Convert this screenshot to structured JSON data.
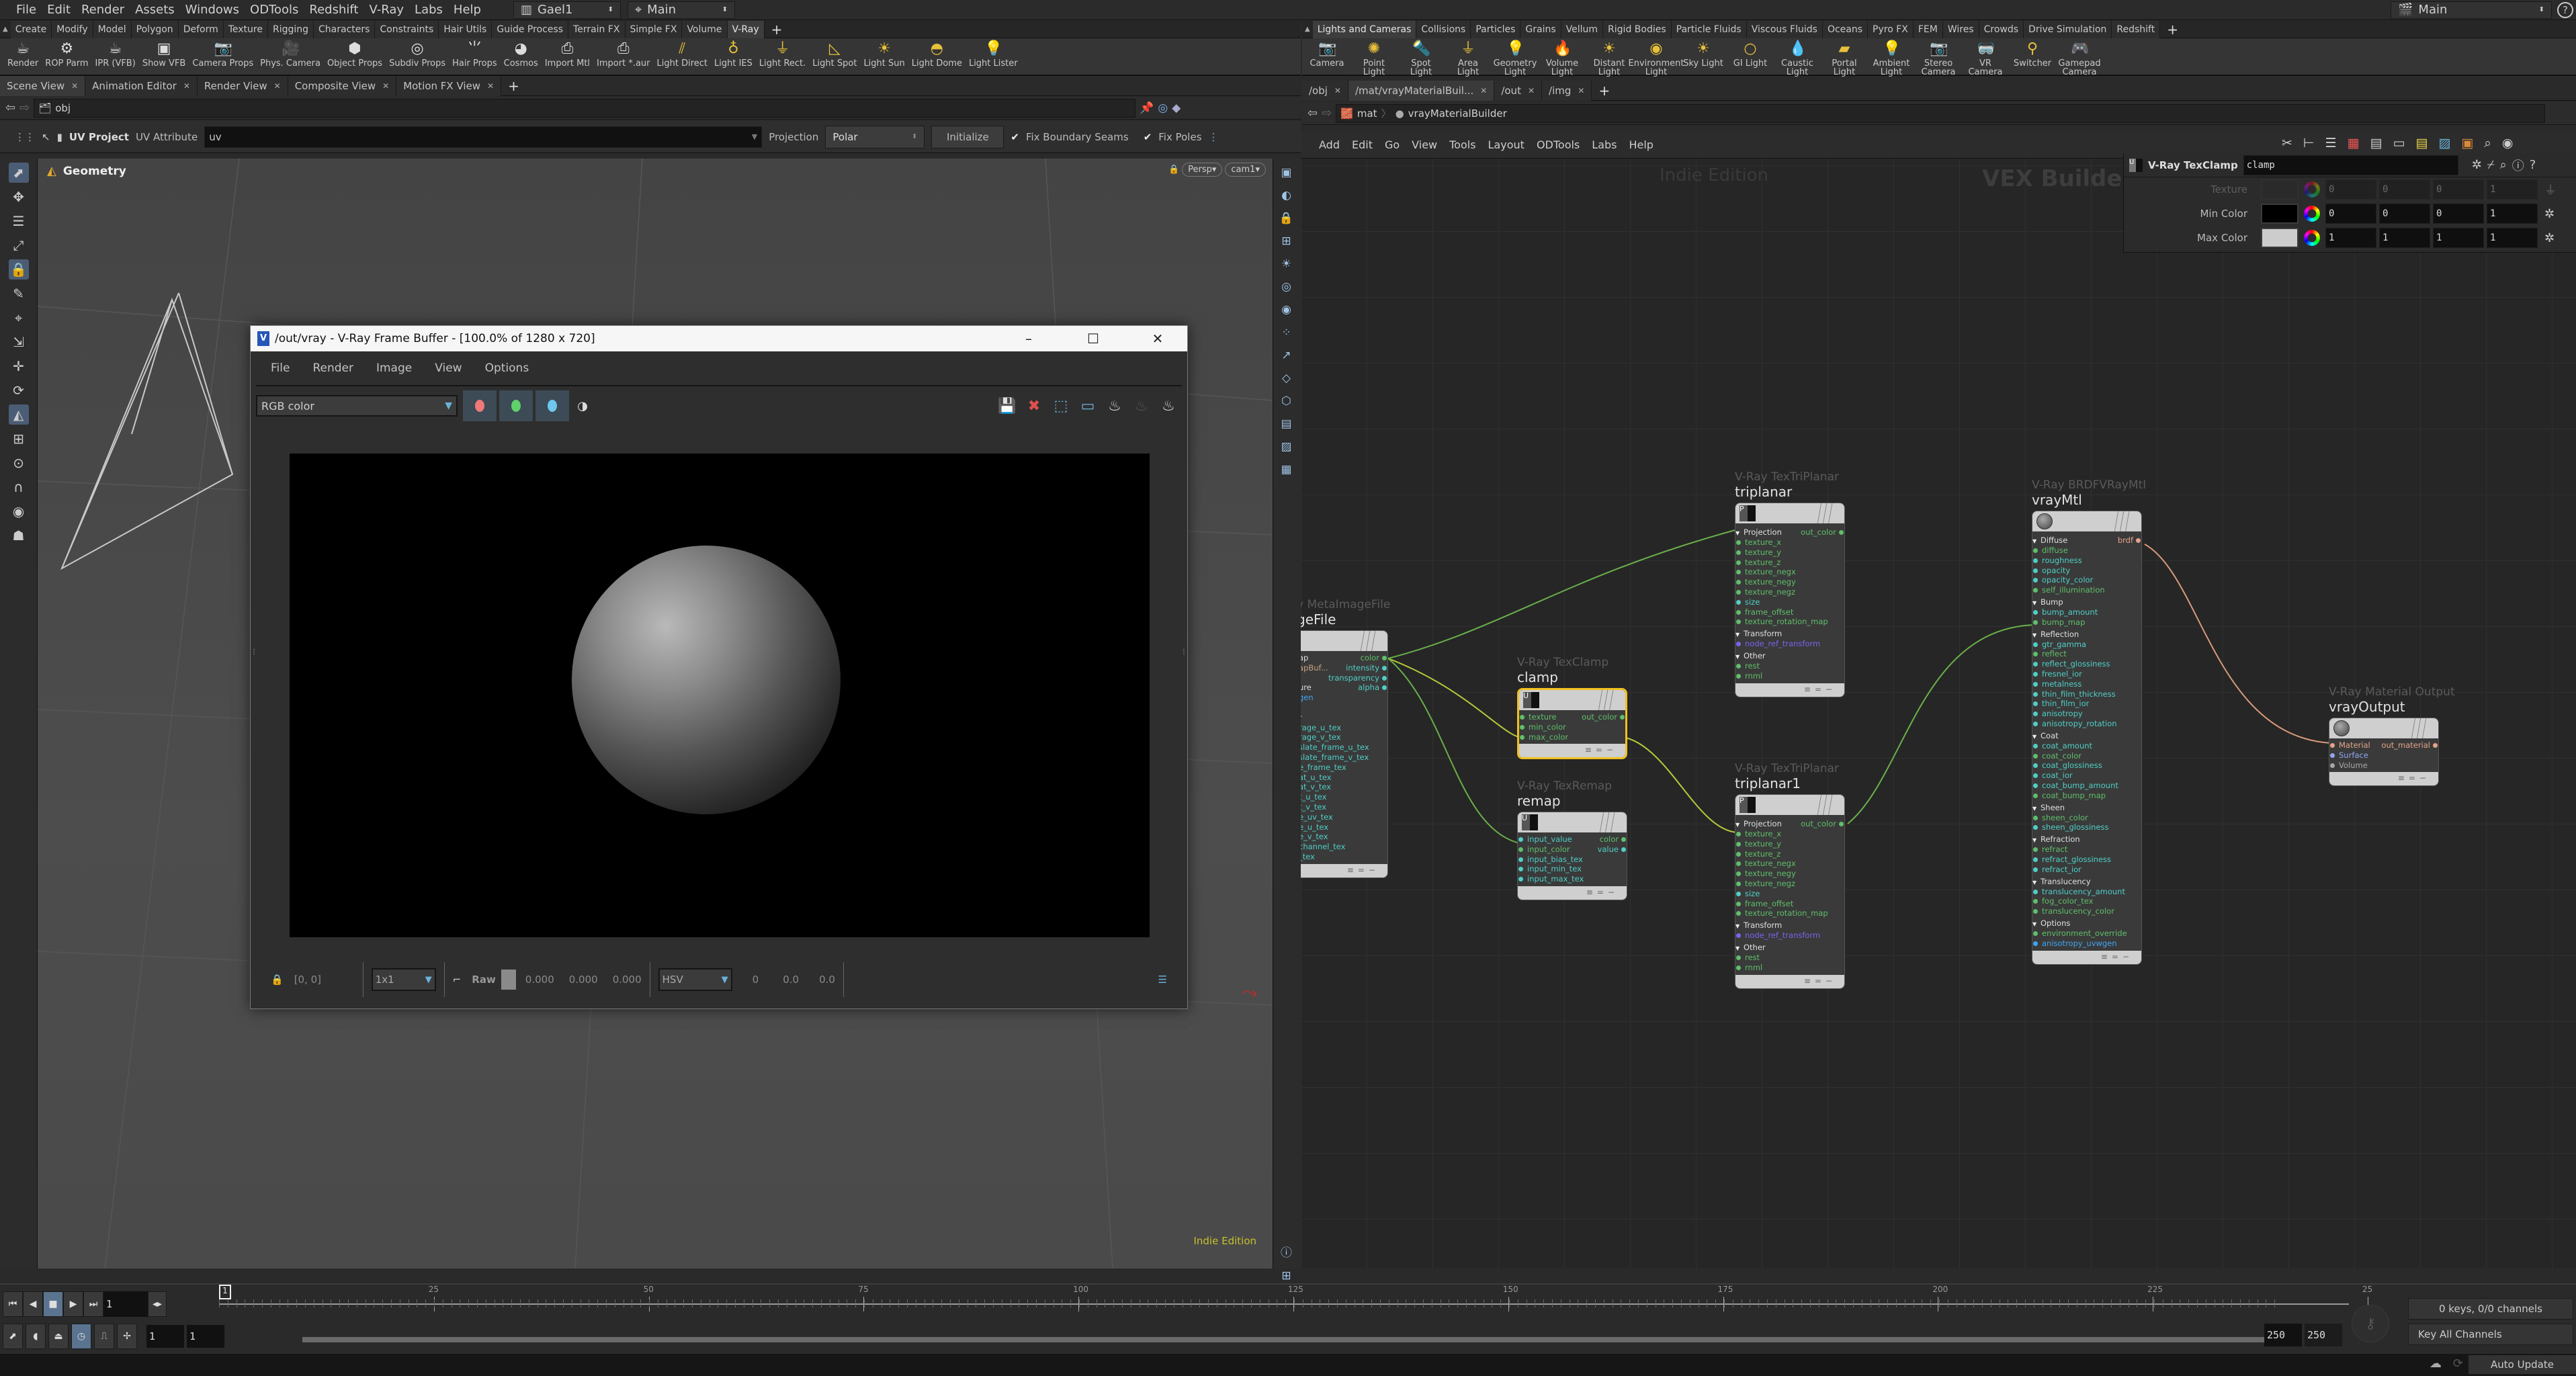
{
  "menubar": {
    "items": [
      "File",
      "Edit",
      "Render",
      "Assets",
      "Windows",
      "ODTools",
      "Redshift",
      "V-Ray",
      "Labs",
      "Help"
    ],
    "desktop": "Gael1",
    "context": "Main",
    "help_icon": "help-icon"
  },
  "left_shelf": {
    "tabs": [
      "Create",
      "Modify",
      "Model",
      "Polygon",
      "Deform",
      "Texture",
      "Rigging",
      "Characters",
      "Constraints",
      "Hair Utils",
      "Guide Process",
      "Terrain FX",
      "Simple FX",
      "Volume",
      "V-Ray"
    ],
    "active_tab": "V-Ray",
    "tools": [
      {
        "label": "Render",
        "icon": "teapot-icon"
      },
      {
        "label": "ROP Parm",
        "icon": "gear-icon"
      },
      {
        "label": "IPR (VFB)",
        "icon": "ipr-teapot-icon"
      },
      {
        "label": "Show VFB",
        "icon": "vfb-icon"
      },
      {
        "label": "Camera Props",
        "icon": "camera-icon"
      },
      {
        "label": "Phys. Camera",
        "icon": "movie-camera-icon"
      },
      {
        "label": "Object Props",
        "icon": "object-gear-icon"
      },
      {
        "label": "Subdiv Props",
        "icon": "subdiv-icon"
      },
      {
        "label": "Hair Props",
        "icon": "hair-icon"
      },
      {
        "label": "Cosmos",
        "icon": "cosmos-icon"
      },
      {
        "label": "Import Mtl",
        "icon": "import-mtl-icon"
      },
      {
        "label": "Import *.aur",
        "icon": "import-aur-icon"
      },
      {
        "label": "Light Direct",
        "icon": "light-direct-icon"
      },
      {
        "label": "Light IES",
        "icon": "light-ies-icon"
      },
      {
        "label": "Light Rect.",
        "icon": "light-rect-icon"
      },
      {
        "label": "Light Spot",
        "icon": "light-spot-icon"
      },
      {
        "label": "Light Sun",
        "icon": "light-sun-icon"
      },
      {
        "label": "Light Dome",
        "icon": "light-dome-icon"
      },
      {
        "label": "Light Lister",
        "icon": "light-lister-icon"
      }
    ]
  },
  "right_shelf": {
    "tabs": [
      "Lights and Cameras",
      "Collisions",
      "Particles",
      "Grains",
      "Vellum",
      "Rigid Bodies",
      "Particle Fluids",
      "Viscous Fluids",
      "Oceans",
      "Pyro FX",
      "FEM",
      "Wires",
      "Crowds",
      "Drive Simulation",
      "Redshift"
    ],
    "active_tab": "Lights and Cameras",
    "tools": [
      "Camera",
      "Point Light",
      "Spot Light",
      "Area Light",
      "Geometry Light",
      "Volume Light",
      "Distant Light",
      "Environment Light",
      "Sky Light",
      "GI Light",
      "Caustic Light",
      "Portal Light",
      "Ambient Light",
      "Stereo Camera",
      "VR Camera",
      "Switcher",
      "Gamepad Camera"
    ]
  },
  "left_pane": {
    "tabs": [
      "Scene View",
      "Animation Editor",
      "Render View",
      "Composite View",
      "Motion FX View"
    ],
    "active_tab": "Scene View",
    "path": "obj",
    "op_toolbar": {
      "tool_name": "UV Project",
      "attr_label": "UV Attribute",
      "attr_value": "uv",
      "projection_label": "Projection",
      "projection_value": "Polar",
      "initialize_label": "Initialize",
      "fix_boundary_label": "Fix Boundary Seams",
      "fix_boundary_checked": true,
      "fix_poles_label": "Fix Poles",
      "fix_poles_checked": true
    },
    "viewport": {
      "context_label": "Geometry",
      "view_menu": "Persp",
      "camera_menu": "cam1",
      "watermark": "Indie Edition"
    }
  },
  "vfb": {
    "title": "/out/vray - V-Ray Frame Buffer - [100.0% of 1280 x 720]",
    "menu": [
      "File",
      "Render",
      "Image",
      "View",
      "Options"
    ],
    "channel": "RGB color",
    "channel_colors": {
      "red": "#f07878",
      "green": "#5fd06a",
      "blue": "#6ec8f0"
    },
    "status": {
      "coords": "[0, 0]",
      "zoom": "1x1",
      "raw_label": "Raw",
      "raw_values": [
        "0.000",
        "0.000",
        "0.000"
      ],
      "color_mode": "HSV",
      "hsv_values": [
        "0",
        "0.0",
        "0.0"
      ]
    }
  },
  "right_pane": {
    "tabs": [
      "/obj",
      "/mat/vrayMaterialBuil...",
      "/out",
      "/img"
    ],
    "active_tab": "/mat/vrayMaterialBuil...",
    "breadcrumb": [
      "mat",
      "vrayMaterialBuilder"
    ],
    "menu": [
      "Add",
      "Edit",
      "Go",
      "View",
      "Tools",
      "Layout",
      "ODTools",
      "Labs",
      "Help"
    ],
    "watermark_left": "Indie Edition",
    "watermark_right": "VEX Builder"
  },
  "params": {
    "node_type": "V-Ray TexClamp",
    "node_name": "clamp",
    "rows": [
      {
        "label": "Texture",
        "values": [
          "0",
          "0",
          "0",
          "1"
        ],
        "swatch": "#2a2a2a",
        "disabled": true
      },
      {
        "label": "Min Color",
        "values": [
          "0",
          "0",
          "0",
          "1"
        ],
        "swatch": "#000000",
        "disabled": false
      },
      {
        "label": "Max Color",
        "values": [
          "1",
          "1",
          "1",
          "1"
        ],
        "swatch": "#cccccc",
        "disabled": false
      }
    ]
  },
  "nodes": {
    "imagefile": {
      "type": "y MetaImageFile",
      "name": "geFile",
      "inputs_left": [
        "ap",
        "apBuf...",
        "",
        "ure",
        "gen",
        "",
        "r",
        "rage_u_tex",
        "rage_v_tex",
        "slate_frame_u_tex",
        "slate_frame_v_tex",
        "e_frame_tex",
        "at_u_tex",
        "at_v_tex",
        "t_u_tex",
        "t_v_tex",
        "e_uv_tex",
        "e_u_tex",
        "e_v_tex",
        "channel_tex",
        "_tex"
      ],
      "outputs": [
        "color",
        "intensity",
        "transparency",
        "alpha"
      ]
    },
    "clamp": {
      "type": "V-Ray TexClamp",
      "name": "clamp",
      "inputs": [
        "texture",
        "min_color",
        "max_color"
      ],
      "outputs": [
        "out_color"
      ]
    },
    "remap": {
      "type": "V-Ray TexRemap",
      "name": "remap",
      "inputs": [
        "input_value",
        "input_color",
        "input_bias_tex",
        "input_min_tex",
        "input_max_tex"
      ],
      "outputs": [
        "color",
        "value"
      ]
    },
    "triplanar": {
      "type": "V-Ray TexTriPlanar",
      "name": "triplanar",
      "groups": [
        {
          "label": "Projection",
          "ports": [
            "texture_x",
            "texture_y",
            "texture_z",
            "texture_negx",
            "texture_negy",
            "texture_negz",
            "size",
            "frame_offset",
            "texture_rotation_map"
          ]
        },
        {
          "label": "Transform",
          "ports": [
            "node_ref_transform"
          ]
        },
        {
          "label": "Other",
          "ports": [
            "rest",
            "rnml"
          ]
        }
      ],
      "outputs": [
        "out_color"
      ]
    },
    "triplanar1": {
      "type": "V-Ray TexTriPlanar",
      "name": "triplanar1",
      "groups": [
        {
          "label": "Projection",
          "ports": [
            "texture_x",
            "texture_y",
            "texture_z",
            "texture_negx",
            "texture_negy",
            "texture_negz",
            "size",
            "frame_offset",
            "texture_rotation_map"
          ]
        },
        {
          "label": "Transform",
          "ports": [
            "node_ref_transform"
          ]
        },
        {
          "label": "Other",
          "ports": [
            "rest",
            "rnml"
          ]
        }
      ],
      "outputs": [
        "out_color"
      ]
    },
    "vraymtl": {
      "type": "V-Ray BRDFVRayMtl",
      "name": "vrayMtl",
      "groups": [
        {
          "label": "Diffuse",
          "ports": [
            "diffuse",
            "roughness",
            "opacity",
            "opacity_color",
            "self_illumination"
          ]
        },
        {
          "label": "Bump",
          "ports": [
            "bump_amount",
            "bump_map"
          ]
        },
        {
          "label": "Reflection",
          "ports": [
            "gtr_gamma",
            "reflect",
            "reflect_glossiness",
            "fresnel_ior",
            "metalness",
            "thin_film_thickness",
            "thin_film_ior",
            "anisotropy",
            "anisotropy_rotation"
          ]
        },
        {
          "label": "Coat",
          "ports": [
            "coat_amount",
            "coat_color",
            "coat_glossiness",
            "coat_ior",
            "coat_bump_amount",
            "coat_bump_map"
          ]
        },
        {
          "label": "Sheen",
          "ports": [
            "sheen_color",
            "sheen_glossiness"
          ]
        },
        {
          "label": "Refraction",
          "ports": [
            "refract",
            "refract_glossiness",
            "refract_ior"
          ]
        },
        {
          "label": "Translucency",
          "ports": [
            "translucency_amount",
            "fog_color_tex",
            "translucency_color"
          ]
        },
        {
          "label": "Options",
          "ports": [
            "environment_override",
            "anisotropy_uvwgen"
          ]
        }
      ],
      "outputs": [
        "brdf"
      ]
    },
    "vrayoutput": {
      "type": "V-Ray Material Output",
      "name": "vrayOutput",
      "inputs": [
        "Material",
        "Surface",
        "Volume"
      ],
      "outputs": [
        "out_material"
      ]
    }
  },
  "timeline": {
    "current_frame": "1",
    "ticks": [
      "25",
      "50",
      "75",
      "100",
      "125",
      "150",
      "175",
      "200",
      "225",
      "25"
    ],
    "range_start": "1",
    "range_start2": "1",
    "range_end": "250",
    "range_end2": "250",
    "keys_status": "0 keys, 0/0 channels",
    "key_mode": "Key All Channels",
    "update_mode": "Auto Update"
  }
}
